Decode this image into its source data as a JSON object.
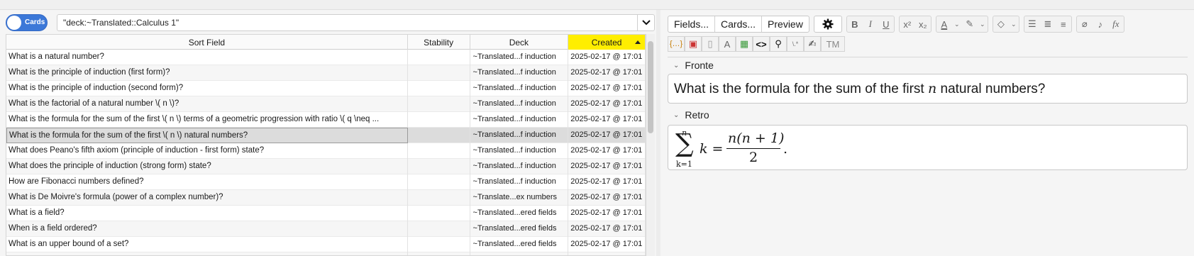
{
  "browser": {
    "mode_toggle_label": "Cards",
    "search_query": "\"deck:~Translated::Calculus 1\"",
    "columns": [
      "Sort Field",
      "Stability",
      "Deck",
      "Created"
    ],
    "rows": [
      {
        "sort_field": "What is a natural number?",
        "stability": "",
        "deck": "~Translated...f induction",
        "created": "2025-02-17 @ 17:01"
      },
      {
        "sort_field": "What is the principle of induction (first form)?",
        "stability": "",
        "deck": "~Translated...f induction",
        "created": "2025-02-17 @ 17:01"
      },
      {
        "sort_field": "What is the principle of induction (second form)?",
        "stability": "",
        "deck": "~Translated...f induction",
        "created": "2025-02-17 @ 17:01"
      },
      {
        "sort_field": "What is the factorial of a natural number \\( n \\)?",
        "stability": "",
        "deck": "~Translated...f induction",
        "created": "2025-02-17 @ 17:01"
      },
      {
        "sort_field": "What is the formula for the sum of the first \\( n \\) terms of a geometric progression with ratio \\( q \\neq ...",
        "stability": "",
        "deck": "~Translated...f induction",
        "created": "2025-02-17 @ 17:01"
      },
      {
        "sort_field": "What is the formula for the sum of the first \\( n \\) natural numbers?",
        "stability": "",
        "deck": "~Translated...f induction",
        "created": "2025-02-17 @ 17:01"
      },
      {
        "sort_field": "What does Peano's fifth axiom (principle of induction - first form) state?",
        "stability": "",
        "deck": "~Translated...f induction",
        "created": "2025-02-17 @ 17:01"
      },
      {
        "sort_field": "What does the principle of induction (strong form) state?",
        "stability": "",
        "deck": "~Translated...f induction",
        "created": "2025-02-17 @ 17:01"
      },
      {
        "sort_field": "How are Fibonacci numbers defined?",
        "stability": "",
        "deck": "~Translated...f induction",
        "created": "2025-02-17 @ 17:01"
      },
      {
        "sort_field": "What is De Moivre's formula (power of a complex number)?",
        "stability": "",
        "deck": "~Translate...ex numbers",
        "created": "2025-02-17 @ 17:01"
      },
      {
        "sort_field": "What is a field?",
        "stability": "",
        "deck": "~Translated...ered fields",
        "created": "2025-02-17 @ 17:01"
      },
      {
        "sort_field": "When is a field ordered?",
        "stability": "",
        "deck": "~Translated...ered fields",
        "created": "2025-02-17 @ 17:01"
      },
      {
        "sort_field": "What is an upper bound of a set?",
        "stability": "",
        "deck": "~Translated...ered fields",
        "created": "2025-02-17 @ 17:01"
      },
      {
        "sort_field": "",
        "stability": "",
        "deck": "",
        "created": ""
      }
    ]
  },
  "editor": {
    "buttons": {
      "fields": "Fields...",
      "cards": "Cards...",
      "preview": "Preview"
    },
    "format": {
      "bold": "B",
      "italic": "I",
      "underline": "U",
      "text_color": "A",
      "font": "A",
      "tm": "TM"
    },
    "front_label": "Fronte",
    "front_before": "What is the formula for the sum of the first ",
    "front_var": "n",
    "front_after": " natural numbers?",
    "back_label": "Retro",
    "math": {
      "sum_top": "n",
      "sum_sign": "∑",
      "sum_bottom": "k=1",
      "term": "k =",
      "numerator": "n(n + 1)",
      "denominator": "2",
      "period": "."
    }
  }
}
